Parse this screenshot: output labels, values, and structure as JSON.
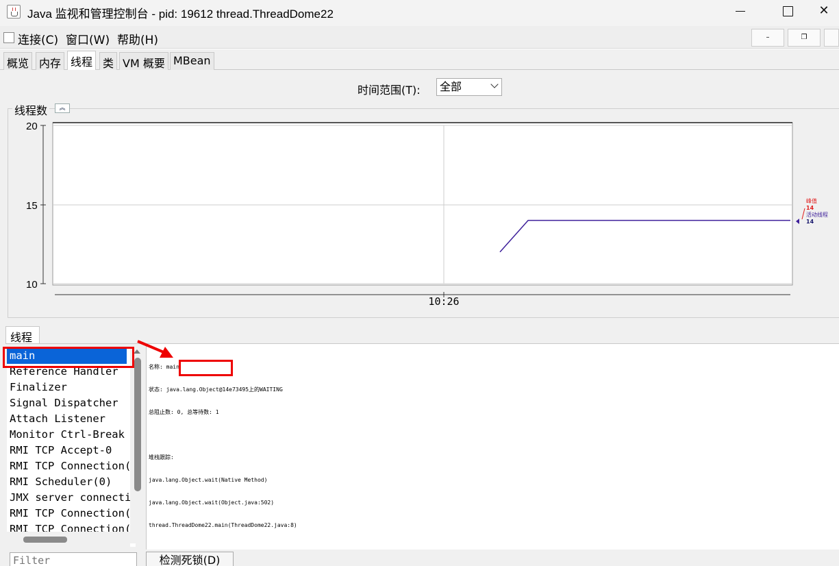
{
  "window": {
    "title": "Java 监视和管理控制台 - pid: 19612 thread.ThreadDome22"
  },
  "menu": {
    "items": [
      "连接(C)",
      "窗口(W)",
      "帮助(H)"
    ]
  },
  "tabs": [
    "概览",
    "内存",
    "线程",
    "类",
    "VM 概要",
    "MBean"
  ],
  "active_tab": "线程",
  "time_range": {
    "label": "时间范围(T):",
    "selected": "全部"
  },
  "chart_panel": {
    "title": "线程数"
  },
  "chart_data": {
    "type": "line",
    "y_ticks": [
      "20",
      "15",
      "10"
    ],
    "ylim": [
      10,
      20
    ],
    "x_ticks": [
      "10:26"
    ],
    "series": [
      {
        "name": "峰值",
        "value_label": "14",
        "color": "#e02020"
      },
      {
        "name": "活动线程",
        "value_label": "14",
        "color": "#3d1f9a",
        "points": [
          [
            0,
            12
          ],
          [
            0.097,
            14
          ],
          [
            0.5,
            14
          ],
          [
            1.0,
            14
          ]
        ]
      }
    ]
  },
  "threads": {
    "tab_label": "线程",
    "items": [
      "main",
      "Reference Handler",
      "Finalizer",
      "Signal Dispatcher",
      "Attach Listener",
      "Monitor Ctrl-Break",
      "RMI TCP Accept-0",
      "RMI TCP Connection(",
      "RMI Scheduler(0)",
      "JMX server connecti",
      "RMI TCP Connection(",
      "RMI TCP Connection("
    ],
    "selected": "main",
    "filter_placeholder": "Filter",
    "deadlock_button": "检测死锁(D)"
  },
  "detail": {
    "lines": [
      "名称: main",
      "状态: java.lang.Object@14e73495上的WAITING",
      "总阻止数: 0, 总等待数: 1",
      "",
      "堆栈跟踪:",
      "java.lang.Object.wait(Native Method)",
      "java.lang.Object.wait(Object.java:502)",
      "thread.ThreadDome22.main(ThreadDome22.java:8)"
    ]
  }
}
